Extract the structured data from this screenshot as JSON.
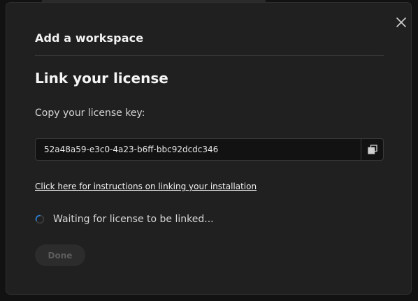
{
  "modal": {
    "header_title": "Add a workspace",
    "section_title": "Link your license",
    "copy_label": "Copy your license key:",
    "license_key": "52a48a59-e3c0-4a23-b6ff-bbc92dcdc346",
    "instructions_link": "Click here for instructions on linking your installation",
    "waiting_text": "Waiting for license to be linked...",
    "done_label": "Done",
    "done_disabled": true
  },
  "icons": {
    "close": "close-icon",
    "copy": "copy-icon",
    "spinner": "loading-spinner-icon"
  },
  "colors": {
    "background": "#121212",
    "modal": "#202020",
    "spinner_accent": "#2d7fd3"
  }
}
